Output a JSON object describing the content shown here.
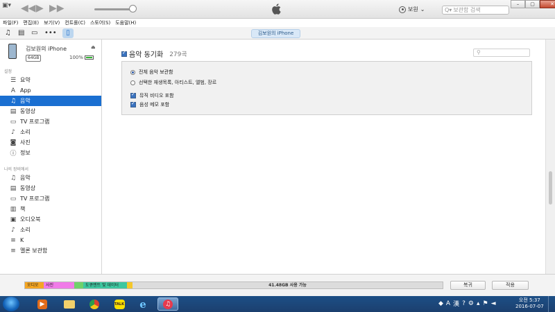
{
  "titlebar": {
    "account_name": "보원",
    "search_placeholder": "보관함 검색"
  },
  "menu": [
    "파일(F)",
    "편집(E)",
    "보기(V)",
    "컨트롤(C)",
    "스토어(S)",
    "도움말(H)"
  ],
  "toolbar": {
    "device_pill": "김보원의 iPhone"
  },
  "device": {
    "name": "김보원의 iPhone",
    "capacity": "64GB",
    "battery": "100%"
  },
  "sidebar": {
    "settings_label": "설정",
    "settings_items": [
      {
        "label": "요약",
        "icon": "list-icon"
      },
      {
        "label": "App",
        "icon": "appstore-icon"
      },
      {
        "label": "음악",
        "icon": "music-note-icon"
      },
      {
        "label": "동영상",
        "icon": "film-icon"
      },
      {
        "label": "TV 프로그램",
        "icon": "tv-icon"
      },
      {
        "label": "소리",
        "icon": "bell-icon"
      },
      {
        "label": "사진",
        "icon": "camera-icon"
      },
      {
        "label": "정보",
        "icon": "info-icon"
      }
    ],
    "selected": "음악",
    "mydevice_label": "나의 장비에서",
    "mydevice_items": [
      {
        "label": "음악",
        "icon": "music-note-icon"
      },
      {
        "label": "동영상",
        "icon": "film-icon"
      },
      {
        "label": "TV 프로그램",
        "icon": "tv-icon"
      },
      {
        "label": "책",
        "icon": "book-icon"
      },
      {
        "label": "오디오북",
        "icon": "audiobook-icon"
      },
      {
        "label": "소리",
        "icon": "bell-icon"
      },
      {
        "label": "K",
        "icon": "playlist-icon"
      },
      {
        "label": "멜론 보관함",
        "icon": "playlist-icon"
      }
    ]
  },
  "main": {
    "sync_label": "음악 동기화",
    "sync_count": "279곡",
    "options": {
      "radio_all": "전체 음악 보관함",
      "radio_selected": "선택한 재생목록, 아티스트, 앨범, 장르",
      "check_video": "뮤직 비디오 포함",
      "check_voice": "음성 메모 포함"
    }
  },
  "capacity": {
    "segments": [
      {
        "label": "오디오",
        "color": "#f5a623"
      },
      {
        "label": "사진",
        "color": "#f07be8"
      },
      {
        "label": "",
        "color": "#6fd16b"
      },
      {
        "label": "도큐멘트 및 데이터",
        "color": "#3ec7a0"
      },
      {
        "label": "",
        "color": "#f5c82a"
      }
    ],
    "free_label": "41.48GB 사용 가능",
    "revert_label": "복귀",
    "apply_label": "적용"
  },
  "taskbar": {
    "time": "오전 5:37",
    "date": "2016-07-07"
  }
}
